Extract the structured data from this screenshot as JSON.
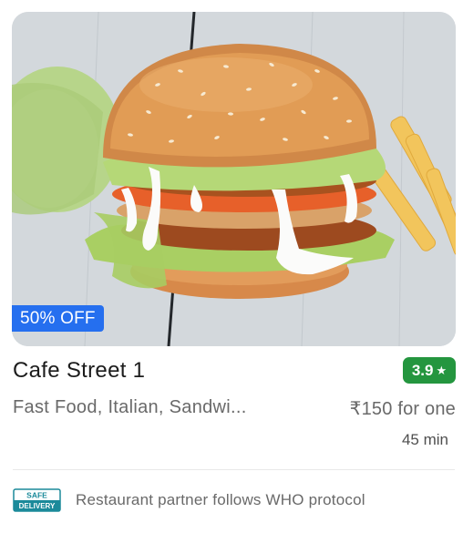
{
  "restaurant": {
    "name": "Cafe Street 1",
    "rating": "3.9",
    "cuisines": "Fast Food, Italian, Sandwi...",
    "price": "₹150 for one",
    "delivery_time": "45 min"
  },
  "offer": {
    "label": "50% OFF"
  },
  "safety": {
    "icon": "safe-delivery-icon",
    "icon_line1": "SAFE",
    "icon_line2": "DELIVERY",
    "text": "Restaurant partner follows WHO protocol"
  },
  "colors": {
    "offer_badge": "#256fef",
    "rating_badge": "#24963f",
    "safe_icon": "#1b8a9a"
  }
}
